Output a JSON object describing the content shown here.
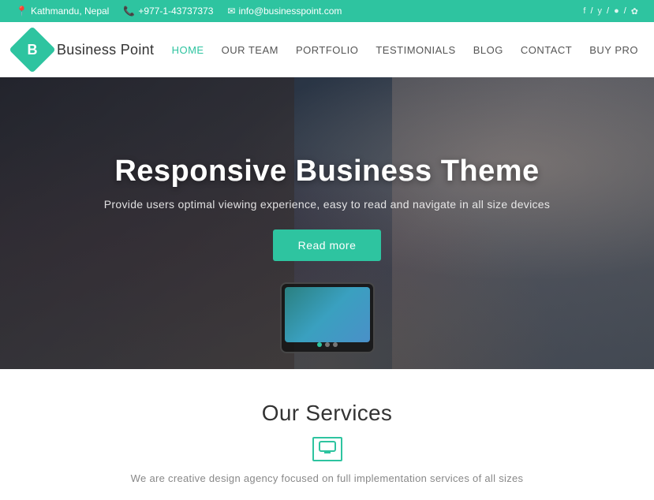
{
  "topbar": {
    "location": "Kathmandu, Nepal",
    "phone": "+977-1-43737373",
    "email": "info@businesspoint.com",
    "social_links": [
      "f",
      "/",
      "y",
      "/",
      "●",
      "/",
      "✿"
    ]
  },
  "header": {
    "logo_letter": "B",
    "logo_text": "Business  Point",
    "nav": [
      {
        "label": "HOME",
        "active": true
      },
      {
        "label": "OUR TEAM",
        "active": false
      },
      {
        "label": "PORTFOLIO",
        "active": false
      },
      {
        "label": "TESTIMONIALS",
        "active": false
      },
      {
        "label": "BLOG",
        "active": false
      },
      {
        "label": "CONTACT",
        "active": false
      },
      {
        "label": "BUY PRO",
        "active": false
      }
    ]
  },
  "hero": {
    "title": "Responsive Business Theme",
    "subtitle": "Provide users optimal viewing experience, easy to read and navigate in all size devices",
    "cta_label": "Read more",
    "slider_dots": [
      {
        "active": true
      },
      {
        "active": false
      },
      {
        "active": false
      }
    ]
  },
  "services": {
    "title": "Our Services",
    "divider_icon": "🖥",
    "subtitle": "We are creative design agency focused on full implementation services of all sizes"
  }
}
